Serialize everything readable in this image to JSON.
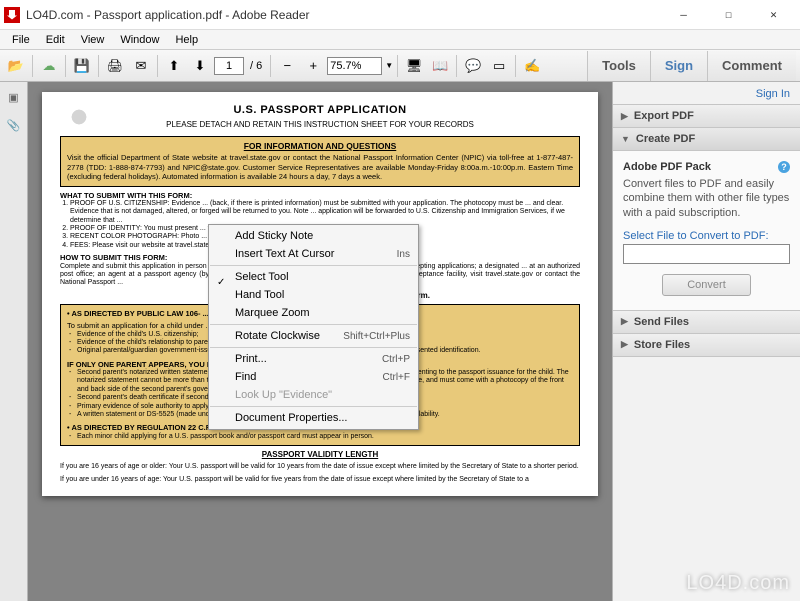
{
  "window": {
    "title": "LO4D.com - Passport application.pdf - Adobe Reader",
    "min": "—",
    "max": "☐",
    "close": "✕"
  },
  "menu": [
    "File",
    "Edit",
    "View",
    "Window",
    "Help"
  ],
  "toolbar": {
    "page_current": "1",
    "page_total": "/ 6",
    "zoom": "75.7%"
  },
  "rtabs": {
    "tools": "Tools",
    "sign": "Sign",
    "comment": "Comment"
  },
  "right": {
    "signin": "Sign In",
    "export": "Export PDF",
    "create": "Create PDF",
    "pack_title": "Adobe PDF Pack",
    "pack_desc": "Convert files to PDF and easily combine them with other file types with a paid subscription.",
    "select_label": "Select File to Convert to PDF:",
    "convert": "Convert",
    "send": "Send Files",
    "store": "Store Files"
  },
  "doc": {
    "title": "U.S. PASSPORT APPLICATION",
    "subtitle": "PLEASE DETACH AND RETAIN THIS INSTRUCTION SHEET FOR YOUR RECORDS",
    "info_head": "FOR INFORMATION AND QUESTIONS",
    "info_body": "Visit the official Department of State website at travel.state.gov or contact the National Passport Information Center (NPIC) via toll-free at 1-877-487-2778 (TDD: 1-888-874-7793) and NPIC@state.gov.  Customer Service Representatives are available Monday-Friday 8:00a.m.-10:00p.m. Eastern Time (excluding federal holidays). Automated information is available 24 hours a day, 7 days a week.",
    "what_head": "WHAT TO SUBMIT WITH THIS FORM:",
    "what_items": [
      "PROOF OF U.S. CITIZENSHIP: Evidence ... (back, if there is printed information) must be submitted with your application. The photocopy must be ... and clear. Evidence that is not damaged, altered, or forged will be returned to you. Note ... application will be forwarded to U.S. Citizenship and Immigration Services, if we determine that ...",
      "PROOF OF IDENTITY: You must present ... front and back with your passport application.",
      "RECENT COLOR PHOTOGRAPH: Photo ... the face and 2x2 inches in size.",
      "FEES: Please visit our website at travel.state.gov ..."
    ],
    "how_head": "HOW TO SUBMIT THIS FORM:",
    "how_body": "Complete and submit this application in person ... a state court of record or a judge or clerk of a probate court accepting applications; a designated ... at an authorized post office; an agent at a passport agency (by appointment only); or a U.S. ... abroad.  To find your nearest acceptance facility, visit travel.state.gov or contact the National Passport ...",
    "follow": "Follow the instructions on ... and submission of this form.",
    "law_head": "AS DIRECTED BY PUBLIC LAW 106- ...",
    "law_body": "To submit an application for a child under ... must appear and present the following:",
    "law_items": [
      "Evidence of the child's U.S. citizenship;",
      "Evidence of the child's relationship to parents/guardian(s); AND",
      "Original parental/guardian government-issued identification AND a photocopy of the front and back side of presented identification."
    ],
    "one_head": "IF ONLY ONE PARENT APPEARS, YOU MUST ALSO SUBMIT ONE OF THE FOLLOWING:",
    "one_items": [
      "Second parent's notarized written statement or DS-3053 (including the child's full name and date of birth) consenting to the passport issuance for the child. The notarized statement cannot be more than three months old and must be signed and notarized on the same date, and must come with a photocopy of the front and back side of the second parent's government-issued photo identification; OR",
      "Second parent's death certificate if second parent is deceased; OR",
      "Primary evidence of sole authority to apply for the child; OR",
      "A written statement or DS-5525 (made under penalty of perjury) explaining in detail the second parent's unavailability."
    ],
    "reg_head": "AS DIRECTED BY REGULATION 22 C.F.R. 51.21 AND 51.28:",
    "reg_item": "Each minor child applying for a U.S. passport book and/or passport card must appear in person.",
    "valid_head": "PASSPORT VALIDITY LENGTH",
    "valid_16": "If you are 16 years of age or older: Your U.S. passport will be valid for 10 years from the date of issue except where limited by the Secretary of State to a shorter period.",
    "valid_u16": "If you are under 16 years of age: Your U.S. passport will be valid for five years from the date of issue except where limited by the Secretary of State to a"
  },
  "context": {
    "sticky": "Add Sticky Note",
    "insert": "Insert Text At Cursor",
    "insert_sc": "Ins",
    "select": "Select Tool",
    "hand": "Hand Tool",
    "marquee": "Marquee Zoom",
    "rotate": "Rotate Clockwise",
    "rotate_sc": "Shift+Ctrl+Plus",
    "print": "Print...",
    "print_sc": "Ctrl+P",
    "find": "Find",
    "find_sc": "Ctrl+F",
    "lookup": "Look Up \"Evidence\"",
    "props": "Document Properties..."
  },
  "watermark": "LO4D.com"
}
